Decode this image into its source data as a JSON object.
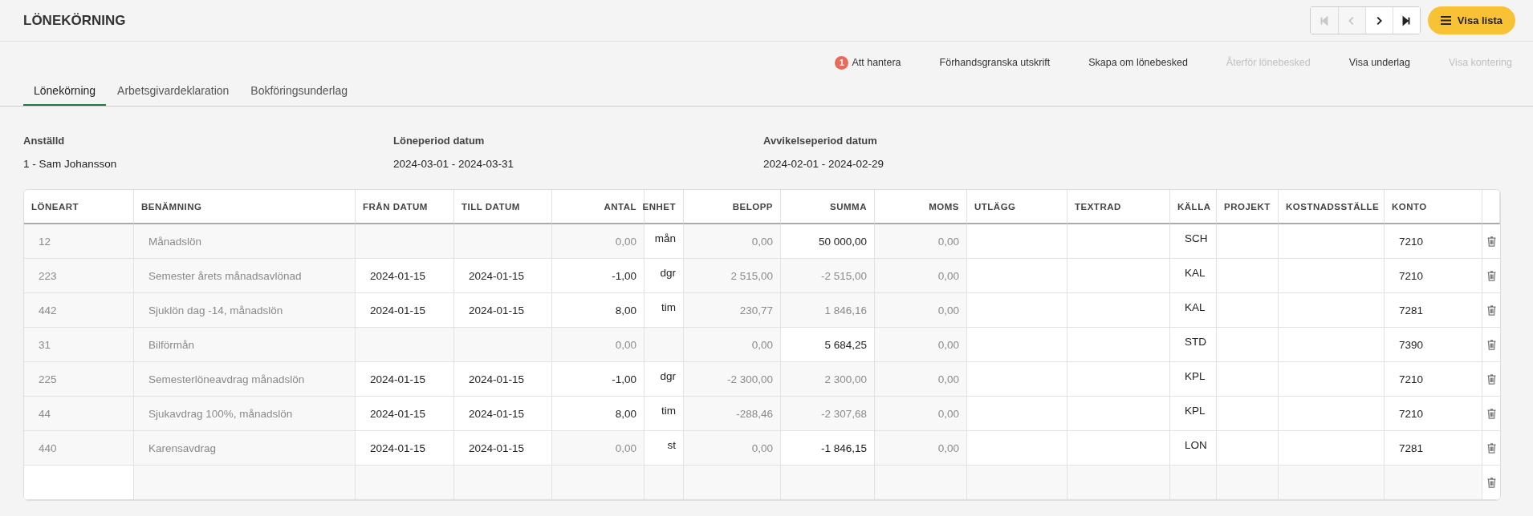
{
  "page_title": "LÖNEKÖRNING",
  "pager": [
    {
      "kind": "first",
      "disabled": true
    },
    {
      "kind": "prev",
      "disabled": true
    },
    {
      "kind": "next",
      "disabled": false
    },
    {
      "kind": "last",
      "disabled": false
    }
  ],
  "list_button": {
    "label": "Visa lista"
  },
  "actions": [
    {
      "label": "Att hantera",
      "badge": "1",
      "disabled": false
    },
    {
      "label": "Förhandsgranska utskrift",
      "disabled": false
    },
    {
      "label": "Skapa om lönebesked",
      "disabled": false
    },
    {
      "label": "Återför lönebesked",
      "disabled": true
    },
    {
      "label": "Visa underlag",
      "disabled": false
    },
    {
      "label": "Visa kontering",
      "disabled": true
    }
  ],
  "tabs": [
    {
      "label": "Lönekörning",
      "selected": true
    },
    {
      "label": "Arbetsgivardeklaration",
      "selected": false
    },
    {
      "label": "Bokföringsunderlag",
      "selected": false
    }
  ],
  "info": [
    {
      "label": "Anställd",
      "value": "1 - Sam Johansson"
    },
    {
      "label": "Löneperiod datum",
      "value": "2024-03-01 - 2024-03-31"
    },
    {
      "label": "Avvikelseperiod datum",
      "value": "2024-02-01 - 2024-02-29"
    }
  ],
  "table": {
    "columns": [
      "LÖNEART",
      "BENÄMNING",
      "FRÅN DATUM",
      "TILL DATUM",
      "ANTAL",
      "ENHET",
      "BELOPP",
      "SUMMA",
      "MOMS",
      "UTLÄGG",
      "TEXTRAD",
      "KÄLLA",
      "PROJEKT",
      "KOSTNADSSTÄLLE",
      "KONTO"
    ],
    "rows": [
      {
        "cells": [
          {
            "text": "12",
            "editable": false
          },
          {
            "text": "Månadslön",
            "editable": false
          },
          null,
          null,
          {
            "text": "0,00",
            "editable": false
          },
          {
            "text": "mån",
            "editable": true
          },
          {
            "text": "0,00",
            "editable": false
          },
          {
            "text": "50 000,00",
            "editable": true
          },
          {
            "text": "0,00",
            "editable": false
          },
          null,
          null,
          {
            "text": "SCH",
            "editable": true
          },
          null,
          null,
          {
            "text": "7210",
            "editable": true
          }
        ]
      },
      {
        "cells": [
          {
            "text": "223",
            "editable": false
          },
          {
            "text": "Semester årets månadsavlönad",
            "editable": false
          },
          {
            "text": "2024-01-15",
            "editable": true
          },
          {
            "text": "2024-01-15",
            "editable": true
          },
          {
            "text": "-1,00",
            "editable": true
          },
          {
            "text": "dgr",
            "editable": true
          },
          {
            "text": "2 515,00",
            "editable": false
          },
          {
            "text": "-2 515,00",
            "editable": false
          },
          {
            "text": "0,00",
            "editable": false
          },
          null,
          null,
          {
            "text": "KAL",
            "editable": true
          },
          null,
          null,
          {
            "text": "7210",
            "editable": true
          }
        ]
      },
      {
        "cells": [
          {
            "text": "442",
            "editable": false
          },
          {
            "text": "Sjuklön dag -14, månadslön",
            "editable": false
          },
          {
            "text": "2024-01-15",
            "editable": true
          },
          {
            "text": "2024-01-15",
            "editable": true
          },
          {
            "text": "8,00",
            "editable": true
          },
          {
            "text": "tim",
            "editable": true
          },
          {
            "text": "230,77",
            "editable": false
          },
          {
            "text": "1 846,16",
            "editable": false
          },
          {
            "text": "0,00",
            "editable": false
          },
          null,
          null,
          {
            "text": "KAL",
            "editable": true
          },
          null,
          null,
          {
            "text": "7281",
            "editable": true
          }
        ]
      },
      {
        "cells": [
          {
            "text": "31",
            "editable": false
          },
          {
            "text": "Bilförmån",
            "editable": false
          },
          null,
          null,
          {
            "text": "0,00",
            "editable": false
          },
          null,
          {
            "text": "0,00",
            "editable": false
          },
          {
            "text": "5 684,25",
            "editable": true
          },
          {
            "text": "0,00",
            "editable": false
          },
          null,
          null,
          {
            "text": "STD",
            "editable": true
          },
          null,
          null,
          {
            "text": "7390",
            "editable": true
          }
        ]
      },
      {
        "cells": [
          {
            "text": "225",
            "editable": false
          },
          {
            "text": "Semesterlöneavdrag månadslön",
            "editable": false
          },
          {
            "text": "2024-01-15",
            "editable": true
          },
          {
            "text": "2024-01-15",
            "editable": true
          },
          {
            "text": "-1,00",
            "editable": true
          },
          {
            "text": "dgr",
            "editable": true
          },
          {
            "text": "-2 300,00",
            "editable": false
          },
          {
            "text": "2 300,00",
            "editable": false
          },
          {
            "text": "0,00",
            "editable": false
          },
          null,
          null,
          {
            "text": "KPL",
            "editable": true
          },
          null,
          null,
          {
            "text": "7210",
            "editable": true
          }
        ]
      },
      {
        "cells": [
          {
            "text": "44",
            "editable": false
          },
          {
            "text": "Sjukavdrag 100%, månadslön",
            "editable": false
          },
          {
            "text": "2024-01-15",
            "editable": true
          },
          {
            "text": "2024-01-15",
            "editable": true
          },
          {
            "text": "8,00",
            "editable": true
          },
          {
            "text": "tim",
            "editable": true
          },
          {
            "text": "-288,46",
            "editable": false
          },
          {
            "text": "-2 307,68",
            "editable": false
          },
          {
            "text": "0,00",
            "editable": false
          },
          null,
          null,
          {
            "text": "KPL",
            "editable": true
          },
          null,
          null,
          {
            "text": "7210",
            "editable": true
          }
        ]
      },
      {
        "cells": [
          {
            "text": "440",
            "editable": false
          },
          {
            "text": "Karensavdrag",
            "editable": false
          },
          {
            "text": "2024-01-15",
            "editable": true
          },
          {
            "text": "2024-01-15",
            "editable": true
          },
          {
            "text": "0,00",
            "editable": false
          },
          {
            "text": "st",
            "editable": true
          },
          {
            "text": "0,00",
            "editable": false
          },
          {
            "text": "-1 846,15",
            "editable": true
          },
          {
            "text": "0,00",
            "editable": false
          },
          null,
          null,
          {
            "text": "LON",
            "editable": true
          },
          null,
          null,
          {
            "text": "7281",
            "editable": true
          }
        ]
      },
      {
        "cells": [
          null,
          null,
          null,
          null,
          null,
          null,
          null,
          null,
          null,
          null,
          null,
          null,
          null,
          null,
          null
        ]
      }
    ]
  }
}
